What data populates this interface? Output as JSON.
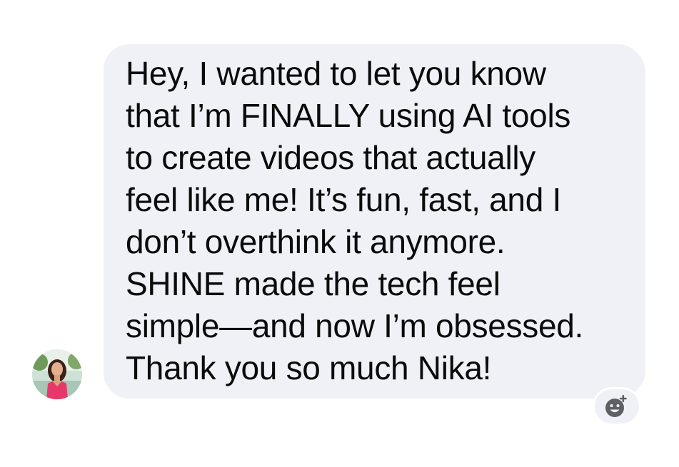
{
  "message": {
    "lines": [
      "Hey, I wanted to let you know",
      "that I’m FINALLY using AI tools",
      "to create videos that actually",
      "feel like me! It’s fun, fast, and I",
      "don’t overthink it anymore.",
      "SHINE made the tech feel",
      "simple—and now I’m obsessed.",
      "Thank you so much Nika!"
    ]
  },
  "sender": {
    "avatar_icon": "avatar-photo"
  },
  "reaction": {
    "icon": "add-reaction-icon"
  },
  "colors": {
    "bubble_background": "#f0f1f6",
    "text": "#0b0b0c",
    "reaction_icon": "#5e6066"
  }
}
